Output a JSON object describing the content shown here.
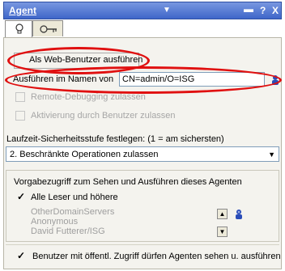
{
  "titlebar": {
    "title": "Agent",
    "dropdown_glyph": "▼",
    "dash_glyph": "▬",
    "help_glyph": "?",
    "close_glyph": "X"
  },
  "tabs": [
    {
      "icon": "lightbulb-icon"
    },
    {
      "icon": "key-icon"
    }
  ],
  "form": {
    "run_as_web_user": "Als Web-Benutzer ausführen",
    "run_on_behalf_label": "Ausführen im Namen von",
    "run_on_behalf_value": "CN=admin/O=ISG",
    "remote_debugging": "Remote-Debugging zulassen",
    "enable_by_users": "Aktivierung durch Benutzer zulassen",
    "security_level_label": "Laufzeit-Sicherheitsstufe festlegen: (1 = am sichersten)",
    "security_level_value": "2. Beschränkte Operationen zulassen",
    "default_access_label": "Vorgabezugriff zum Sehen und Ausführen dieses Agenten",
    "all_readers": "Alle Leser und höhere",
    "access_list": [
      "OtherDomainServers",
      "Anonymous",
      "David Futterer/ISG"
    ],
    "public_access": "Benutzer mit öffentl. Zugriff dürfen Agenten sehen u. ausführen"
  },
  "colors": {
    "titlebar": "#3f66c9",
    "highlight": "#e01010"
  }
}
